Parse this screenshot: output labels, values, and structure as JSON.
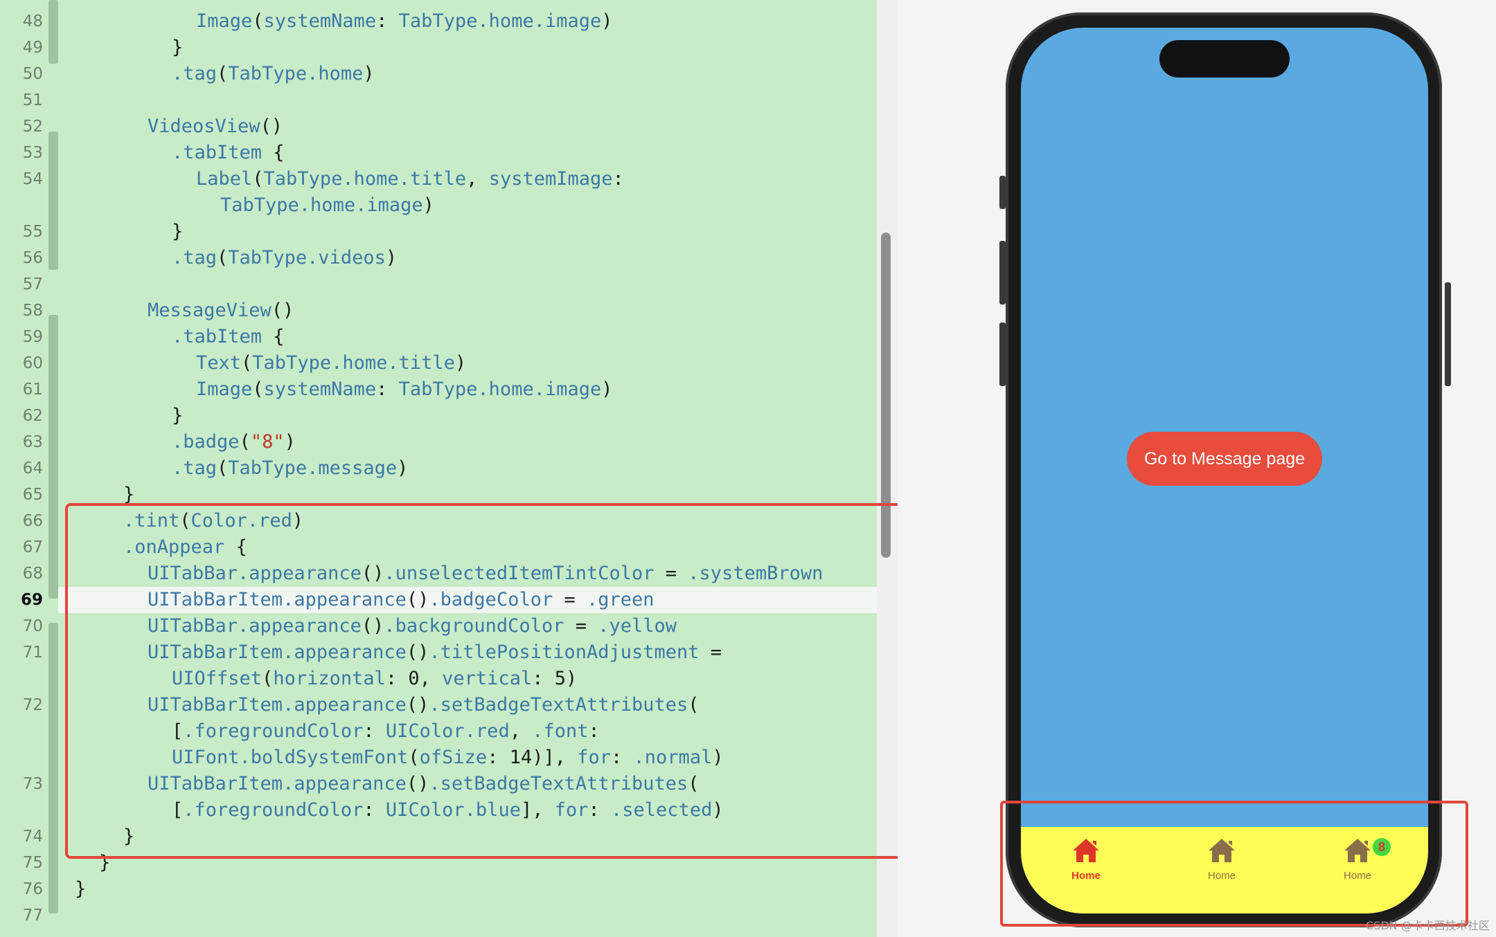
{
  "editor": {
    "active_line": 69,
    "lines": [
      {
        "no": "48",
        "text": "Image(systemName: TabType.home.image)",
        "indent": 5
      },
      {
        "no": "49",
        "text": "}",
        "indent": 4
      },
      {
        "no": "50",
        "text": ".tag(TabType.home)",
        "indent": 4
      },
      {
        "no": "51",
        "text": "",
        "indent": 0
      },
      {
        "no": "52",
        "text": "VideosView()",
        "indent": 3
      },
      {
        "no": "53",
        "text": ".tabItem {",
        "indent": 4
      },
      {
        "no": "54",
        "text": "Label(TabType.home.title, systemImage:",
        "indent": 5
      },
      {
        "no": "",
        "text": "TabType.home.image)",
        "indent": 6
      },
      {
        "no": "55",
        "text": "}",
        "indent": 4
      },
      {
        "no": "56",
        "text": ".tag(TabType.videos)",
        "indent": 4
      },
      {
        "no": "57",
        "text": "",
        "indent": 0
      },
      {
        "no": "58",
        "text": "MessageView()",
        "indent": 3
      },
      {
        "no": "59",
        "text": ".tabItem {",
        "indent": 4
      },
      {
        "no": "60",
        "text": "Text(TabType.home.title)",
        "indent": 5
      },
      {
        "no": "61",
        "text": "Image(systemName: TabType.home.image)",
        "indent": 5
      },
      {
        "no": "62",
        "text": "}",
        "indent": 4
      },
      {
        "no": "63",
        "text": ".badge(\"8\")",
        "indent": 4
      },
      {
        "no": "64",
        "text": ".tag(TabType.message)",
        "indent": 4
      },
      {
        "no": "65",
        "text": "}",
        "indent": 2
      },
      {
        "no": "66",
        "text": ".tint(Color.red)",
        "indent": 2
      },
      {
        "no": "67",
        "text": ".onAppear {",
        "indent": 2
      },
      {
        "no": "68",
        "text": "UITabBar.appearance().unselectedItemTintColor = .systemBrown",
        "indent": 3
      },
      {
        "no": "69",
        "text": "UITabBarItem.appearance().badgeColor = .green",
        "indent": 3
      },
      {
        "no": "70",
        "text": "UITabBar.appearance().backgroundColor = .yellow",
        "indent": 3
      },
      {
        "no": "71",
        "text": "UITabBarItem.appearance().titlePositionAdjustment =",
        "indent": 3
      },
      {
        "no": "",
        "text": "UIOffset(horizontal: 0, vertical: 5)",
        "indent": 4
      },
      {
        "no": "72",
        "text": "UITabBarItem.appearance().setBadgeTextAttributes(",
        "indent": 3
      },
      {
        "no": "",
        "text": "[.foregroundColor: UIColor.red, .font:",
        "indent": 4
      },
      {
        "no": "",
        "text": "UIFont.boldSystemFont(ofSize: 14)], for: .normal)",
        "indent": 4
      },
      {
        "no": "73",
        "text": "UITabBarItem.appearance().setBadgeTextAttributes(",
        "indent": 3
      },
      {
        "no": "",
        "text": "[.foregroundColor: UIColor.blue], for: .selected)",
        "indent": 4
      },
      {
        "no": "74",
        "text": "}",
        "indent": 2
      },
      {
        "no": "75",
        "text": "}",
        "indent": 1
      },
      {
        "no": "76",
        "text": "}",
        "indent": 0
      },
      {
        "no": "77",
        "text": "",
        "indent": 0
      }
    ]
  },
  "preview": {
    "button_label": "Go to Message page",
    "screen_color": "#5aa9e0",
    "tabbar_color": "#fdfd55",
    "tabs": [
      {
        "label": "Home",
        "icon": "house-fill-icon",
        "selected": true,
        "color": "#e0352b"
      },
      {
        "label": "Home",
        "icon": "house-fill-icon",
        "selected": false,
        "color": "#8a6e4b"
      },
      {
        "label": "Home",
        "icon": "house-fill-icon",
        "selected": false,
        "color": "#8a6e4b",
        "badge": "8"
      }
    ]
  },
  "watermark": "CSDN @卡卡西技术社区"
}
